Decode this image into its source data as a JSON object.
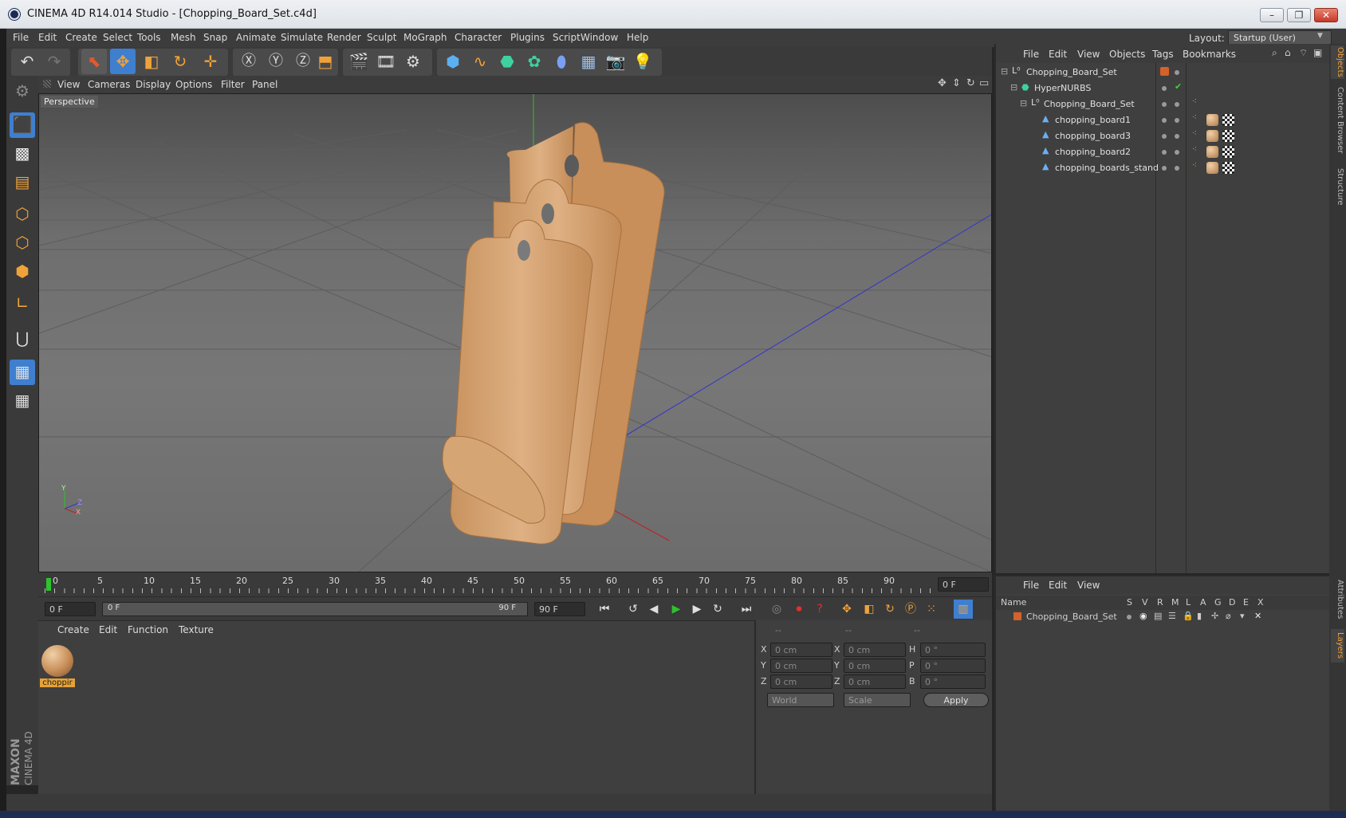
{
  "window": {
    "title": "CINEMA 4D R14.014 Studio - [Chopping_Board_Set.c4d]",
    "min": "–",
    "max": "❐",
    "close": "✕"
  },
  "menubar": {
    "items": [
      "File",
      "Edit",
      "Create",
      "Select",
      "Tools",
      "Mesh",
      "Snap",
      "Animate",
      "Simulate",
      "Render",
      "Sculpt",
      "MoGraph",
      "Character",
      "Plugins",
      "Script",
      "Window",
      "Help"
    ],
    "layout_label": "Layout:",
    "layout_value": "Startup (User)"
  },
  "viewport": {
    "menu": [
      "View",
      "Cameras",
      "Display",
      "Options",
      "Filter",
      "Panel"
    ],
    "label": "Perspective",
    "axis_y": "Y",
    "axis_z": "Z",
    "axis_x": "X"
  },
  "timeline": {
    "ticks": [
      "0",
      "5",
      "10",
      "15",
      "20",
      "25",
      "30",
      "35",
      "40",
      "45",
      "50",
      "55",
      "60",
      "65",
      "70",
      "75",
      "80",
      "85",
      "90"
    ],
    "current_frame": "0 F"
  },
  "transport": {
    "start_field": "0 F",
    "range_start": "0 F",
    "range_end": "90 F",
    "end_field": "90 F"
  },
  "material_manager": {
    "menu": [
      "Create",
      "Edit",
      "Function",
      "Texture"
    ],
    "material_name": "choppir"
  },
  "coords": {
    "headers": [
      "--",
      "--",
      "--"
    ],
    "rows": [
      {
        "a": "X",
        "v1": "0 cm",
        "b": "X",
        "v2": "0 cm",
        "c": "H",
        "v3": "0 °"
      },
      {
        "a": "Y",
        "v1": "0 cm",
        "b": "Y",
        "v2": "0 cm",
        "c": "P",
        "v3": "0 °"
      },
      {
        "a": "Z",
        "v1": "0 cm",
        "b": "Z",
        "v2": "0 cm",
        "c": "B",
        "v3": "0 °"
      }
    ],
    "mode1": "World",
    "mode2": "Scale",
    "apply": "Apply"
  },
  "object_manager": {
    "menu": [
      "File",
      "Edit",
      "View",
      "Objects",
      "Tags",
      "Bookmarks"
    ],
    "objects": [
      {
        "name": "Chopping_Board_Set",
        "indent": 0
      },
      {
        "name": "HyperNURBS",
        "indent": 1
      },
      {
        "name": "Chopping_Board_Set",
        "indent": 2
      },
      {
        "name": "chopping_board1",
        "indent": 3
      },
      {
        "name": "chopping_board3",
        "indent": 3
      },
      {
        "name": "chopping_board2",
        "indent": 3
      },
      {
        "name": "chopping_boards_stand",
        "indent": 3
      }
    ]
  },
  "layer_manager": {
    "menu": [
      "File",
      "Edit",
      "View"
    ],
    "col_name": "Name",
    "cols": [
      "S",
      "V",
      "R",
      "M",
      "L",
      "A",
      "G",
      "D",
      "E",
      "X"
    ],
    "layer_name": "Chopping_Board_Set"
  },
  "side_tabs": [
    "Objects",
    "Content Browser",
    "Structure",
    "Attributes",
    "Layers"
  ],
  "branding": {
    "line1": "MAXON",
    "line2": "CINEMA 4D"
  },
  "colors": {
    "accent": "#f0a23a",
    "wood": "#d9a978",
    "layer_color": "#d4622a"
  }
}
